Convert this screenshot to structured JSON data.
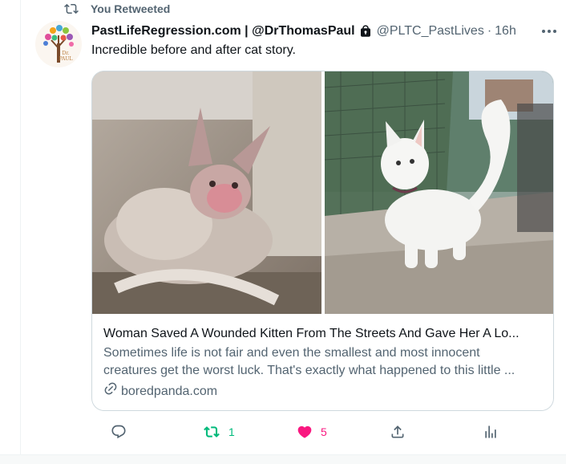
{
  "retweet_context": {
    "label": "You Retweeted",
    "icon": "retweet-icon"
  },
  "author": {
    "display_name": "PastLifeRegression.com | @DrThomasPaul",
    "handle": "@PLTC_PastLives",
    "separator": "·",
    "time": "16h",
    "protected_icon": "lock-icon",
    "avatar_text": "Dr. PAUL"
  },
  "tweet": {
    "text": "Incredible before and after cat story."
  },
  "card": {
    "title": "Woman Saved A Wounded Kitten From The Streets And Gave Her A Lo...",
    "description_line1": "Sometimes life is not fair and even the smallest and most innocent",
    "description_line2": "creatures get the worst luck. That's exactly what happened to this little ...",
    "domain": "boredpanda.com"
  },
  "actions": {
    "reply": {
      "icon": "reply-icon",
      "count": ""
    },
    "retweet": {
      "icon": "retweet-icon",
      "count": "1",
      "color": "#00ba7c"
    },
    "like": {
      "icon": "heart-icon",
      "count": "5",
      "color": "#f91880"
    },
    "share": {
      "icon": "share-icon"
    },
    "analytics": {
      "icon": "analytics-icon"
    }
  },
  "colors": {
    "secondary_text": "#536471",
    "primary_text": "#0f1419",
    "border": "#cfd9de"
  }
}
